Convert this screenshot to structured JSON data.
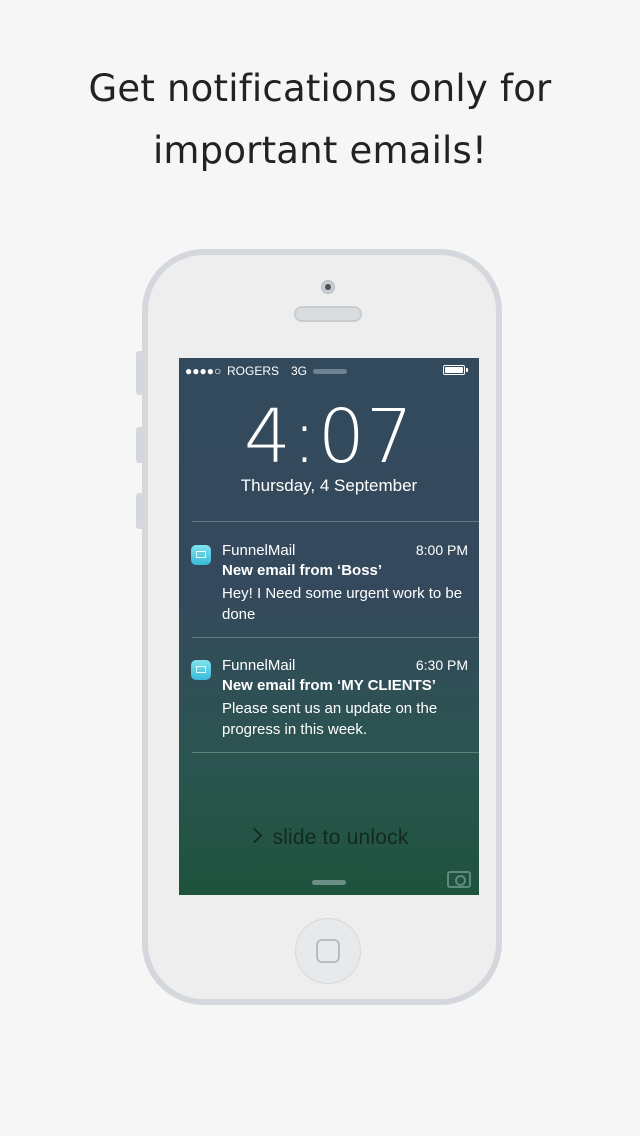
{
  "headline": {
    "line1": "Get notifications only for",
    "line2": "important emails!"
  },
  "status_bar": {
    "signal": "●●●●○",
    "carrier": "ROGERS",
    "network": "3G"
  },
  "lock_screen": {
    "time": "4:07",
    "date": "Thursday, 4 September"
  },
  "notifications": [
    {
      "app": "FunnelMail",
      "time": "8:00 PM",
      "title": "New email from ‘Boss’",
      "body": "Hey! I Need some urgent work to be done"
    },
    {
      "app": "FunnelMail",
      "time": "6:30 PM",
      "title": "New email from ‘MY CLIENTS’",
      "body": "Please sent us an update on the progress in this week."
    }
  ],
  "slide_to_unlock": "slide to unlock",
  "icons": {
    "app": "mail-icon",
    "camera": "camera-icon",
    "battery": "battery-icon",
    "chevron": "chevron-right-icon",
    "home": "home-button"
  },
  "colors": {
    "screen_top": "#334a5d",
    "screen_bottom": "#1f533d",
    "phone_frame": "#d4d8dc"
  }
}
